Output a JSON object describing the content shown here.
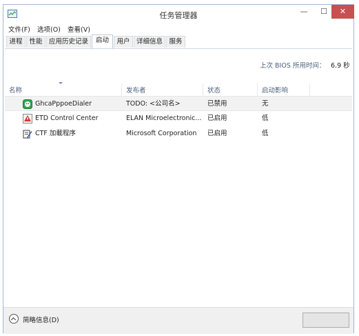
{
  "window": {
    "title": "任务管理器",
    "controls": {
      "minimize": "—",
      "maximize": "☐",
      "close": "✕"
    }
  },
  "menu": [
    {
      "label": "文件(F)"
    },
    {
      "label": "选项(O)"
    },
    {
      "label": "查看(V)"
    }
  ],
  "tabs": [
    {
      "label": "进程"
    },
    {
      "label": "性能"
    },
    {
      "label": "应用历史记录"
    },
    {
      "label": "启动",
      "active": true
    },
    {
      "label": "用户"
    },
    {
      "label": "详细信息"
    },
    {
      "label": "服务"
    }
  ],
  "bios": {
    "label": "上次 BIOS 所用时间：",
    "value": "6.9 秒"
  },
  "columns": {
    "name": "名称",
    "publisher": "发布者",
    "status": "状态",
    "impact": "启动影响"
  },
  "rows": [
    {
      "name": "GhcaPppoeDialer",
      "publisher": "TODO: <公司名>",
      "status": "已禁用",
      "impact": "无",
      "icon": "dialer-icon",
      "selected": true
    },
    {
      "name": "ETD Control Center",
      "publisher": "ELAN Microelectronic...",
      "status": "已启用",
      "impact": "低",
      "icon": "etd-icon"
    },
    {
      "name": "CTF 加載程序",
      "publisher": "Microsoft Corporation",
      "status": "已启用",
      "impact": "低",
      "icon": "ctf-icon"
    }
  ],
  "footer": {
    "fewer_details": "简略信息(D)"
  },
  "colors": {
    "selected_row": "#f2f2f2",
    "header_text": "#4c607a",
    "close_button": "#c75050"
  }
}
